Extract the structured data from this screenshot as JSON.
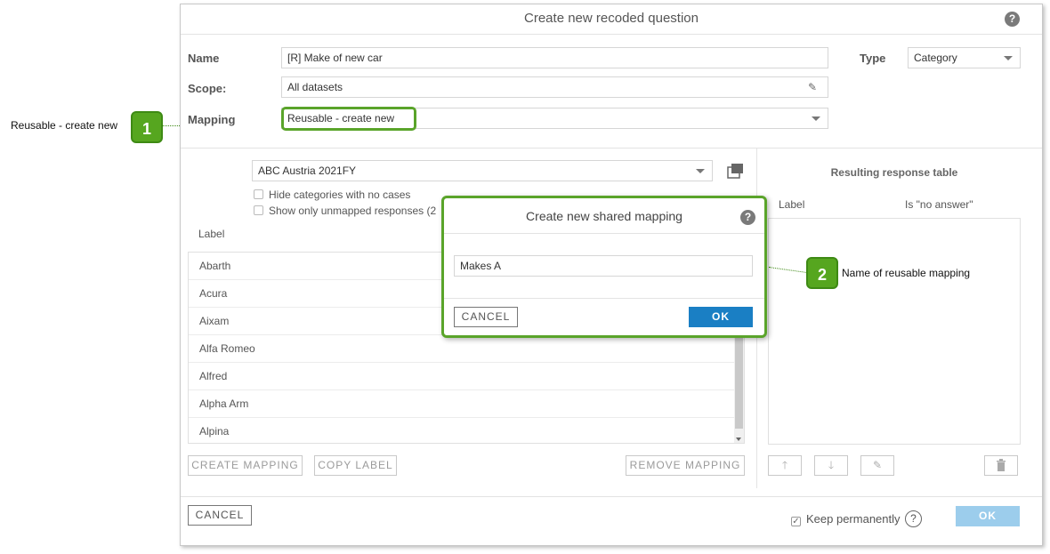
{
  "dialog": {
    "title": "Create new recoded question",
    "name_label": "Name",
    "name_value": "[R] Make of new car",
    "type_label": "Type",
    "type_value": "Category",
    "scope_label": "Scope:",
    "scope_value": "All datasets",
    "mapping_label": "Mapping",
    "mapping_value": "Reusable - create new"
  },
  "left_panel": {
    "dataset": "ABC Austria 2021FY",
    "hide_categories": "Hide categories with no cases",
    "show_unmapped": "Show only unmapped responses (2",
    "label_header": "Label",
    "rows": [
      "Abarth",
      "Acura",
      "Aixam",
      "Alfa Romeo",
      "Alfred",
      "Alpha Arm",
      "Alpina"
    ],
    "create_mapping": "CREATE MAPPING",
    "copy_label": "COPY LABEL",
    "remove_mapping": "REMOVE MAPPING"
  },
  "right_panel": {
    "title": "Resulting response table",
    "col_label": "Label",
    "col_no_answer": "Is \"no answer\"",
    "icons": [
      "arrow-up-icon",
      "arrow-down-icon",
      "pencil-icon",
      "trash-icon"
    ]
  },
  "footer": {
    "cancel": "CANCEL",
    "keep_permanently": "Keep permanently",
    "ok": "OK"
  },
  "subdialog": {
    "title": "Create new shared mapping",
    "value": "Makes A",
    "cancel": "CANCEL",
    "ok": "OK"
  },
  "callouts": {
    "one_num": "1",
    "one_text": "Reusable - create new",
    "two_num": "2",
    "two_text": "Name of reusable mapping"
  },
  "colors": {
    "accent_green": "#5aa42a",
    "primary_blue": "#1a7fc4",
    "disabled_blue": "#9ccdec"
  }
}
